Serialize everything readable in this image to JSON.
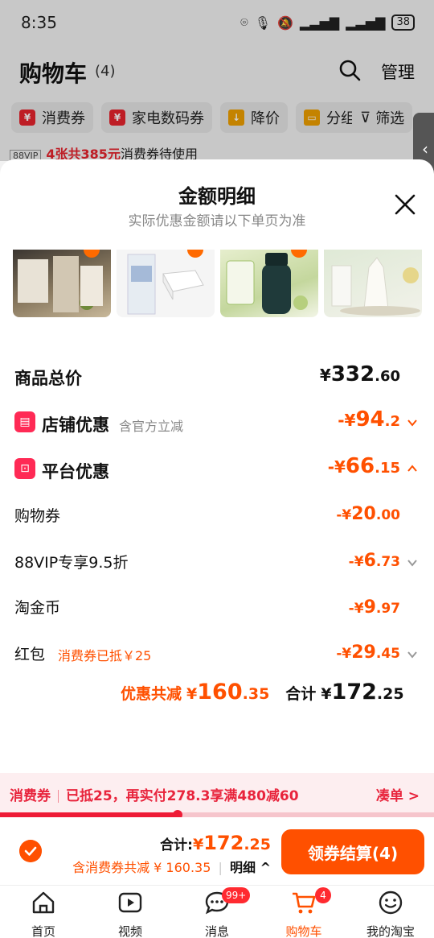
{
  "status_bar": {
    "time": "8:35",
    "battery": "38"
  },
  "background_page": {
    "title": "购物车",
    "count": "(4)",
    "manage_label": "管理",
    "chips": [
      {
        "icon": "coupon-icon",
        "label": "消费券"
      },
      {
        "icon": "coupon-icon",
        "label": "家电数码券"
      },
      {
        "icon": "price-down-icon",
        "label": "降价"
      },
      {
        "icon": "folder-icon",
        "label": "分组"
      },
      {
        "icon": "filter-icon",
        "label": "筛选"
      }
    ],
    "vip_tag": "88VIP",
    "banner_highlight": "4张共385元",
    "banner_rest": "消费券待使用"
  },
  "sheet": {
    "title": "金额明细",
    "subtitle": "实际优惠金额请以下单页为准",
    "product_total": {
      "label": "商品总价",
      "yen": "¥",
      "int": "332",
      "dec": ".60"
    },
    "store_discount": {
      "label": "店铺优惠",
      "note": "含官方立减",
      "yen": "-¥",
      "int": "94",
      "dec": ".2"
    },
    "platform_discount": {
      "label": "平台优惠",
      "yen": "-¥",
      "int": "66",
      "dec": ".15"
    },
    "items": [
      {
        "label": "购物券",
        "yen": "-¥",
        "int": "20",
        "dec": ".00",
        "chevron": false
      },
      {
        "label": "88VIP专享9.5折",
        "yen": "-¥",
        "int": "6",
        "dec": ".73",
        "chevron": true
      },
      {
        "label": "淘金币",
        "yen": "-¥",
        "int": "9",
        "dec": ".97",
        "chevron": false
      },
      {
        "label": "红包",
        "note": "消费券已抵￥25",
        "yen": "-¥",
        "int": "29",
        "dec": ".45",
        "chevron": true
      }
    ],
    "summary": {
      "discount_label": "优惠共减",
      "discount_yen": "¥",
      "discount_int": "160",
      "discount_dec": ".35",
      "total_label": "合计",
      "total_yen": "¥",
      "total_int": "172",
      "total_dec": ".25"
    }
  },
  "coupon_strip": {
    "label": "消费券",
    "text": "已抵25，再实付278.3享满480减60",
    "action": "凑单 >",
    "progress": 0.41
  },
  "action_bar": {
    "total_label": "合计:",
    "total_yen": "¥",
    "total_int": "172",
    "total_dec": ".25",
    "incl_text": "含消费券共减 ¥ 160.35",
    "detail_label": "明细",
    "checkout_label": "领券结算(4)"
  },
  "tabbar": [
    {
      "icon": "home-icon",
      "label": "首页",
      "badge": ""
    },
    {
      "icon": "video-icon",
      "label": "视频",
      "badge": ""
    },
    {
      "icon": "message-icon",
      "label": "消息",
      "badge": "99+"
    },
    {
      "icon": "cart-icon",
      "label": "购物车",
      "badge": "4",
      "active": true
    },
    {
      "icon": "my-taobao-icon",
      "label": "我的淘宝",
      "badge": ""
    }
  ],
  "colors": {
    "accent": "#ff5000",
    "red": "#e8242e",
    "coupon_red": "#e8243c"
  }
}
